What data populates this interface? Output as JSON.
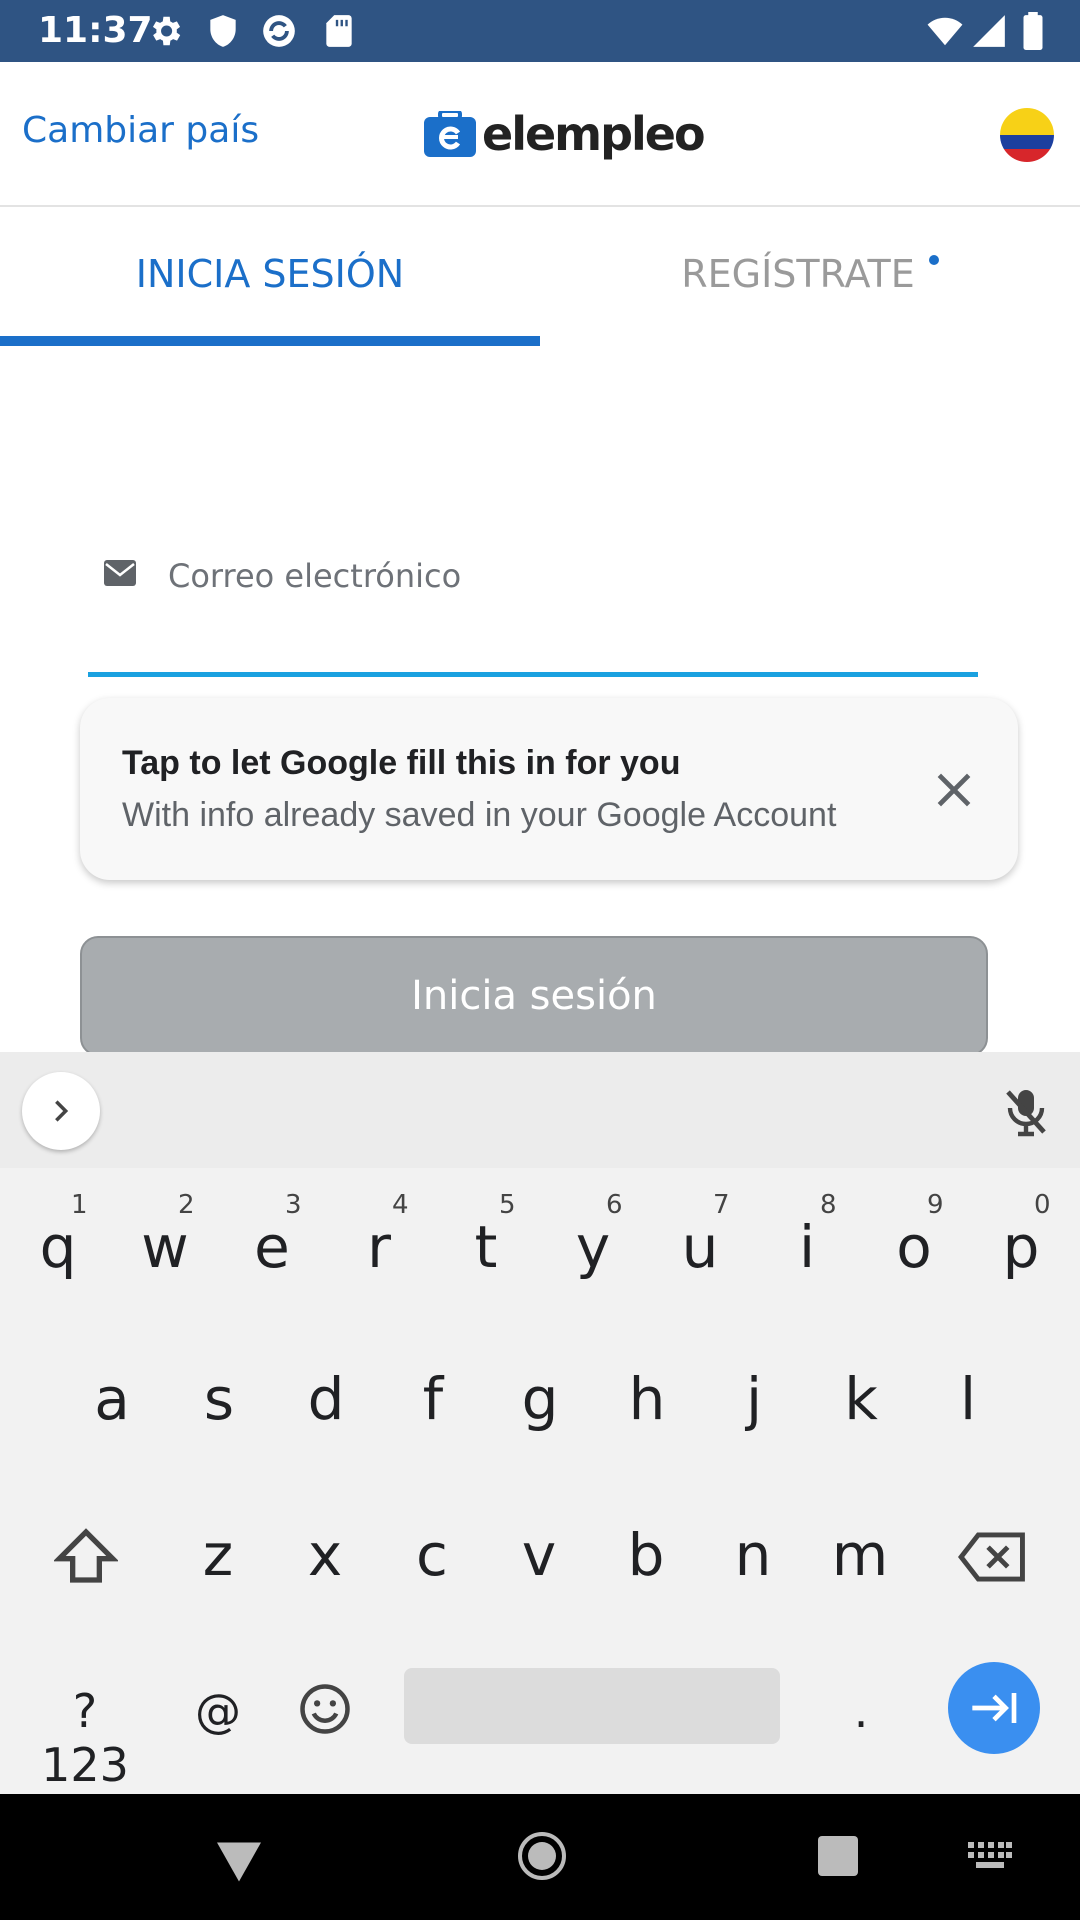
{
  "status_bar": {
    "time": "11:37",
    "icons": [
      "settings-icon",
      "shield-icon",
      "sync-icon",
      "sd-card-icon",
      "wifi-icon",
      "cell-signal-icon",
      "battery-icon"
    ]
  },
  "header": {
    "change_country": "Cambiar país",
    "logo_text": "elempleo",
    "flag": "colombia-flag"
  },
  "tabs": {
    "login": "INICIA SESIÓN",
    "register": "REGÍSTRATE"
  },
  "form": {
    "email_placeholder": "Correo electrónico",
    "email_value": "",
    "login_button": "Inicia sesión"
  },
  "autofill": {
    "title": "Tap to let Google fill this in for you",
    "subtitle": "With info already saved in your Google Account"
  },
  "keyboard": {
    "row1": [
      {
        "c": "q",
        "h": "1"
      },
      {
        "c": "w",
        "h": "2"
      },
      {
        "c": "e",
        "h": "3"
      },
      {
        "c": "r",
        "h": "4"
      },
      {
        "c": "t",
        "h": "5"
      },
      {
        "c": "y",
        "h": "6"
      },
      {
        "c": "u",
        "h": "7"
      },
      {
        "c": "i",
        "h": "8"
      },
      {
        "c": "o",
        "h": "9"
      },
      {
        "c": "p",
        "h": "0"
      }
    ],
    "row2": [
      "a",
      "s",
      "d",
      "f",
      "g",
      "h",
      "j",
      "k",
      "l"
    ],
    "row3": [
      "z",
      "x",
      "c",
      "v",
      "b",
      "n",
      "m"
    ],
    "symbols_key": "?123",
    "at_key": "@",
    "period_key": "."
  },
  "colors": {
    "accent": "#1b6fc9",
    "status_bar": "#2f5483",
    "button_disabled": "#a8acaf",
    "underline": "#1aa1e0"
  }
}
